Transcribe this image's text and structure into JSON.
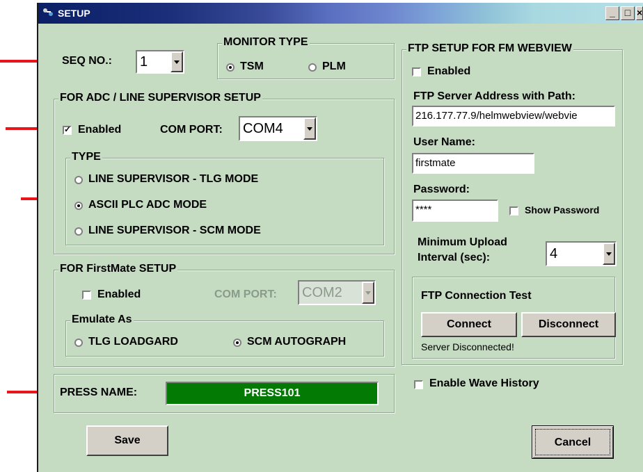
{
  "window": {
    "title": "SETUP",
    "minimize": "_",
    "maximize": "□",
    "close": "×"
  },
  "seq": {
    "label": "SEQ NO.:",
    "value": "1"
  },
  "monitor_type": {
    "caption": "MONITOR TYPE",
    "options": [
      "TSM",
      "PLM"
    ],
    "selected": "TSM"
  },
  "adc": {
    "caption": "FOR ADC / LINE SUPERVISOR SETUP",
    "enabled_label": "Enabled",
    "enabled": true,
    "com_port_label": "COM PORT:",
    "com_port_value": "COM4",
    "type_caption": "TYPE",
    "types": [
      "LINE SUPERVISOR - TLG MODE",
      "ASCII PLC ADC MODE",
      "LINE SUPERVISOR - SCM MODE"
    ],
    "selected_type": "ASCII PLC ADC MODE"
  },
  "firstmate": {
    "caption": "FOR FirstMate SETUP",
    "enabled_label": "Enabled",
    "enabled": false,
    "com_port_label": "COM PORT:",
    "com_port_value": "COM2",
    "emulate_caption": "Emulate As",
    "options": [
      "TLG LOADGARD",
      "SCM AUTOGRAPH"
    ],
    "selected": "SCM AUTOGRAPH"
  },
  "press": {
    "label": "PRESS NAME:",
    "value": "PRESS101",
    "color": "#037a03"
  },
  "ftp": {
    "caption": "FTP SETUP FOR FM WEBVIEW",
    "enabled_label": "Enabled",
    "enabled": false,
    "server_label": "FTP Server Address with Path:",
    "server_value": "216.177.77.9/helmwebview/webvie",
    "user_label": "User Name:",
    "user_value": "firstmate",
    "password_label": "Password:",
    "password_value": "****",
    "show_password_label": "Show Password",
    "interval_label_1": "Minimum Upload",
    "interval_label_2": "Interval (sec):",
    "interval_value": "4",
    "test_caption": "FTP Connection Test",
    "connect_label": "Connect",
    "disconnect_label": "Disconnect",
    "status": "Server Disconnected!"
  },
  "wave_history": {
    "label": "Enable Wave History",
    "enabled": false
  },
  "buttons": {
    "save": "Save",
    "cancel": "Cancel"
  },
  "colors": {
    "dialog_bg": "#c5dcc3",
    "annotation_arrow": "#e8161b"
  }
}
